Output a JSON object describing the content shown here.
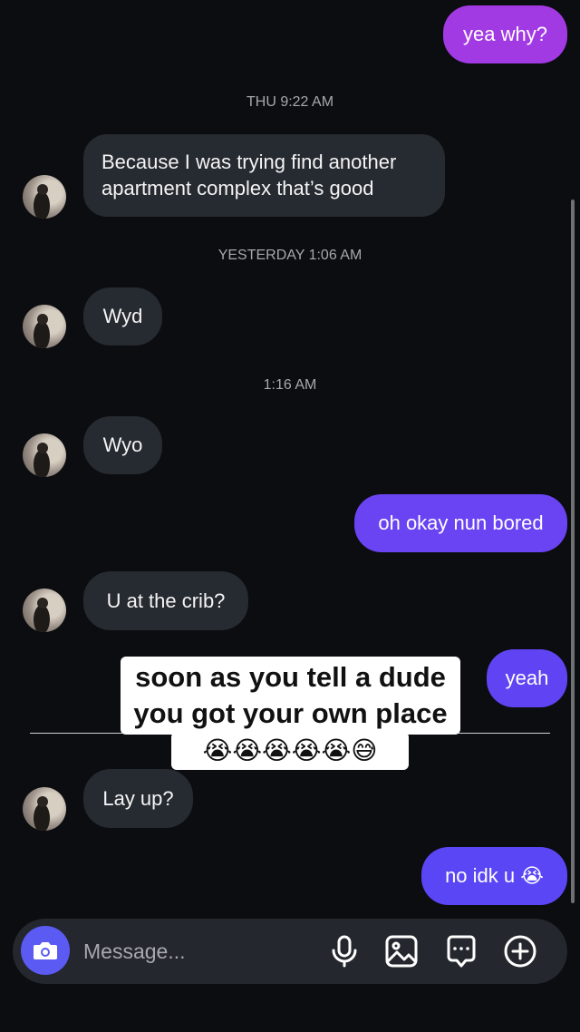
{
  "thread": {
    "messages": [
      {
        "side": "out",
        "text": "yea why?"
      },
      {
        "side": "timestamp",
        "text": "THU 9:22 AM"
      },
      {
        "side": "in",
        "lines": [
          "Because I was trying find another",
          "apartment complex that’s good"
        ]
      },
      {
        "side": "timestamp",
        "text": "YESTERDAY 1:06 AM"
      },
      {
        "side": "in",
        "text": "Wyd"
      },
      {
        "side": "timestamp",
        "text": "1:16 AM"
      },
      {
        "side": "in",
        "text": "Wyo"
      },
      {
        "side": "out",
        "text": "oh okay nun bored"
      },
      {
        "side": "in",
        "text": "U at the crib?"
      },
      {
        "side": "out",
        "text": "yeah"
      },
      {
        "side": "in",
        "text": "Lay up?"
      },
      {
        "side": "out",
        "text": "no idk u 😭"
      }
    ]
  },
  "overlay_caption": {
    "lines": [
      "soon as you tell a dude",
      "you got your own place",
      "😭😭😭😭😭😅"
    ]
  },
  "composer": {
    "placeholder": "Message...",
    "icons": [
      "camera-icon",
      "microphone-icon",
      "gallery-icon",
      "sticker-chat-icon",
      "plus-circle-icon"
    ]
  },
  "colors": {
    "background": "#0c0d10",
    "incoming_bubble": "#262a31",
    "outgoing_gradient_top": "#a33be4",
    "outgoing_gradient_bottom": "#5b45f5",
    "camera_button": "#5b5bf4"
  }
}
